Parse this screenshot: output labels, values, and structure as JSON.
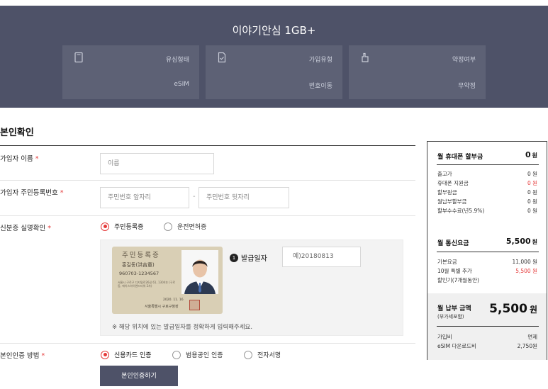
{
  "plan": {
    "title": "이야기안심 1GB+",
    "cards": [
      {
        "label": "유심형태",
        "value": "eSIM",
        "icon": "sim-card-icon"
      },
      {
        "label": "가입유형",
        "value": "번호이동",
        "icon": "document-check-icon"
      },
      {
        "label": "약정여부",
        "value": "무약정",
        "icon": "hand-icon"
      }
    ]
  },
  "form": {
    "section_title": "본인확인",
    "required_mark": "*",
    "name": {
      "label": "가입자 이름",
      "placeholder": "이름"
    },
    "rrn": {
      "label": "가입자 주민등록번호",
      "front_placeholder": "주민번호 앞자리",
      "separator": "-",
      "back_placeholder": "주민번호 뒷자리"
    },
    "id_verify": {
      "label": "신분증 실명확인",
      "options": [
        {
          "label": "주민등록증",
          "selected": true
        },
        {
          "label": "운전면허증",
          "selected": false
        }
      ],
      "card": {
        "title": "주민등록증",
        "name": "홍길동(洪吉童)",
        "number": "960703-1234567",
        "address": "서울시 구로구 디지털로26길 61, 1304호 (구로동, 에이스하이엔드타워 2차)",
        "date": "2020. 11. 16",
        "issuer": "서울특별시 구로구청장"
      },
      "issue_badge": "1",
      "issue_label": "발급일자",
      "issue_placeholder": "예)20180813",
      "note": "※ 해당 위치에 있는 발급일자를 정확하게 입력해주세요."
    },
    "auth_method": {
      "label": "본인인증 방법",
      "options": [
        {
          "label": "신용카드 인증",
          "selected": true
        },
        {
          "label": "범용공인 인증",
          "selected": false
        },
        {
          "label": "전자서명",
          "selected": false
        }
      ],
      "button": "본인인증하기"
    }
  },
  "summary": {
    "phone": {
      "title": "월 휴대폰 할부금",
      "amount": "0",
      "unit": "원",
      "items": [
        {
          "label": "출고가",
          "value": "0 원",
          "red": false
        },
        {
          "label": "휴대폰 지원금",
          "value": "0 원",
          "red": true
        },
        {
          "label": "할부원금",
          "value": "0 원",
          "red": false
        },
        {
          "label": "월납부할부금",
          "value": "0 원",
          "red": false
        },
        {
          "label": "할부수수료(년5.9%)",
          "value": "0 원",
          "red": false
        }
      ]
    },
    "telecom": {
      "title": "월 통신요금",
      "amount": "5,500",
      "unit": "원",
      "items": [
        {
          "label": "기본요금",
          "value": "11,000 원",
          "red": false
        },
        {
          "label": "10월 특별 추가",
          "value": "5,500 원",
          "red": true
        },
        {
          "label": "할인기(7개월동안)",
          "value": "",
          "red": false
        }
      ]
    },
    "total": {
      "title": "월 납부 금액",
      "subtitle": "(부가세포함)",
      "amount": "5,500",
      "unit": "원",
      "items": [
        {
          "label": "가입비",
          "value": "면제"
        },
        {
          "label": "eSIM 다운로드비",
          "value": "2,750원"
        }
      ]
    }
  },
  "colors": {
    "banner": "#4e5268",
    "card": "#5d6175",
    "accent_red": "#e53a3a"
  }
}
